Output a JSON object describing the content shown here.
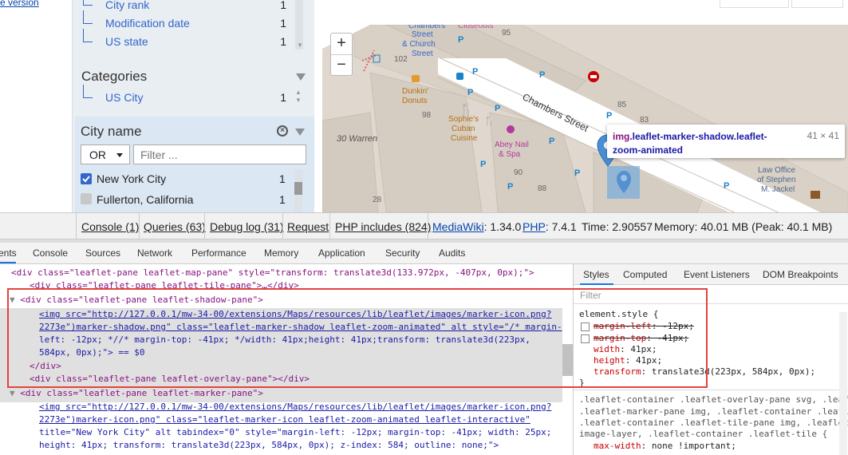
{
  "left_link": "e version",
  "sidebar": {
    "top_rows": [
      {
        "label": "City rank",
        "count": "1"
      },
      {
        "label": "Modification date",
        "count": "1"
      },
      {
        "label": "US state",
        "count": "1"
      }
    ],
    "categories": {
      "title": "Categories",
      "rows": [
        {
          "label": "US City",
          "count": "1"
        }
      ]
    },
    "city_name": {
      "title": "City name",
      "operator": "OR",
      "filter_placeholder": "Filter ...",
      "rows": [
        {
          "label": "New York City",
          "count": "1",
          "checked": true
        },
        {
          "label": "Fullerton, California",
          "count": "1",
          "checked": false
        }
      ]
    }
  },
  "map": {
    "labels": [
      "Chambers Street & Church Street",
      "Closeouts",
      "Dunkin' Donuts",
      "Sophie's Cuban Cuisine",
      "Abey Nail & Spa",
      "Chambers Street",
      "30 Warren",
      "Law Office of Stephen M. Jackel"
    ],
    "house_numbers": [
      "95",
      "102",
      "98",
      "85",
      "83",
      "90",
      "88",
      "28"
    ],
    "zoom_in": "+",
    "zoom_out": "−"
  },
  "tooltip": {
    "tag": "img",
    "classes": ".leaflet-marker-shadow.leaflet-zoom-animated",
    "dims": "41 × 41"
  },
  "debug_bar": {
    "items": [
      "Console (1)",
      "Queries (63)",
      "Debug log (31)",
      "Request",
      "PHP includes (824)"
    ],
    "mediawiki_label": "MediaWiki",
    "mediawiki_version": ": 1.34.0",
    "php_label": "PHP",
    "php_version": ": 7.4.1",
    "time": "Time: 2.90557",
    "memory": "Memory: 40.01 MB (Peak: 40.1 MB)"
  },
  "devtools": {
    "tabs": [
      "ents",
      "Console",
      "Sources",
      "Network",
      "Performance",
      "Memory",
      "Application",
      "Security",
      "Audits"
    ],
    "dom_lines": [
      "<div class=\"leaflet-pane leaflet-map-pane\" style=\"transform: translate3d(133.972px, -407px, 0px);\">",
      "<div class=\"leaflet-pane leaflet-tile-pane\">…</div>",
      "<div class=\"leaflet-pane leaflet-shadow-pane\">",
      "<img src=\"http://127.0.0.1/mw-34-00/extensions/Maps/resources/lib/leaflet/images/marker-icon.png?",
      "2273e\")marker-shadow.png\" class=\"leaflet-marker-shadow leaflet-zoom-animated\" alt style=\"/* margin-",
      "left: -12px; *//* margin-top: -41px; */width: 41px;height: 41px;transform: translate3d(223px,",
      "584px, 0px);\"> == $0",
      "</div>",
      "<div class=\"leaflet-pane leaflet-overlay-pane\"></div>",
      "<div class=\"leaflet-pane leaflet-marker-pane\">",
      "<img src=\"http://127.0.0.1/mw-34-00/extensions/Maps/resources/lib/leaflet/images/marker-icon.png?",
      "2273e\")marker-icon.png\" class=\"leaflet-marker-icon leaflet-zoom-animated leaflet-interactive\"",
      "title=\"New York City\" alt tabindex=\"0\" style=\"margin-left: -12px; margin-top: -41px; width: 25px;",
      "height: 41px; transform: translate3d(223px, 584px, 0px); z-index: 584; outline: none;\">"
    ],
    "styles_tabs": [
      "Styles",
      "Computed",
      "Event Listeners",
      "DOM Breakpoints"
    ],
    "styles_filter": "Filter",
    "style_lines": {
      "selector": "element.style {",
      "props": [
        {
          "name": "margin-left",
          "value": "-12px;",
          "disabled": true
        },
        {
          "name": "margin-top",
          "value": "-41px;",
          "disabled": true
        },
        {
          "name": "width",
          "value": "41px;",
          "disabled": false
        },
        {
          "name": "height",
          "value": "41px;",
          "disabled": false
        },
        {
          "name": "transform",
          "value": "translate3d(223px, 584px, 0px);",
          "disabled": false
        }
      ],
      "close": "}",
      "rule2": [
        ".leaflet-container .leaflet-overlay-pane svg, .leaf",
        ".leaflet-marker-pane img, .leaflet-container .leafl",
        ".leaflet-container .leaflet-tile-pane img, .leaflet",
        "image-layer, .leaflet-container .leaflet-tile {"
      ],
      "rule2_prop": "max-width",
      "rule2_value": "none !important;"
    }
  },
  "colors": {
    "accent": "#3366cc",
    "highlight_border": "#e0443e",
    "marker": "#4a8fd6"
  }
}
